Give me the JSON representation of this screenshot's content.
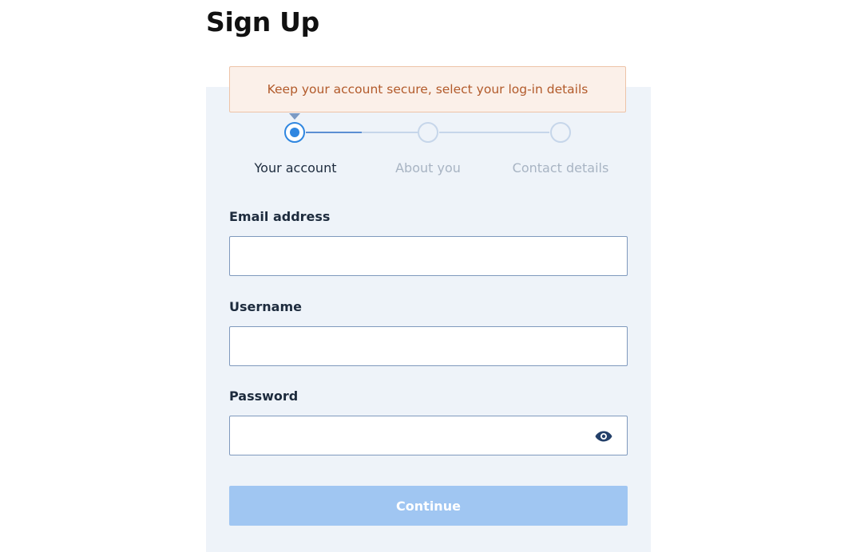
{
  "page": {
    "title": "Sign Up"
  },
  "banner": {
    "message": "Keep your account secure, select your log-in details"
  },
  "steps": [
    {
      "label": "Your account",
      "state": "active"
    },
    {
      "label": "About you",
      "state": "pending"
    },
    {
      "label": "Contact details",
      "state": "pending"
    }
  ],
  "form": {
    "email": {
      "label": "Email address",
      "value": "",
      "placeholder": ""
    },
    "username": {
      "label": "Username",
      "value": "",
      "placeholder": ""
    },
    "password": {
      "label": "Password",
      "value": "",
      "placeholder": "",
      "toggle_icon": "eye-icon"
    },
    "continue_label": "Continue"
  },
  "colors": {
    "accent": "#2f86e0",
    "button_disabled": "#a0c6f2",
    "banner_bg": "#fbf0e9",
    "banner_text": "#b25a2a",
    "panel_bg": "#eef3f9"
  }
}
